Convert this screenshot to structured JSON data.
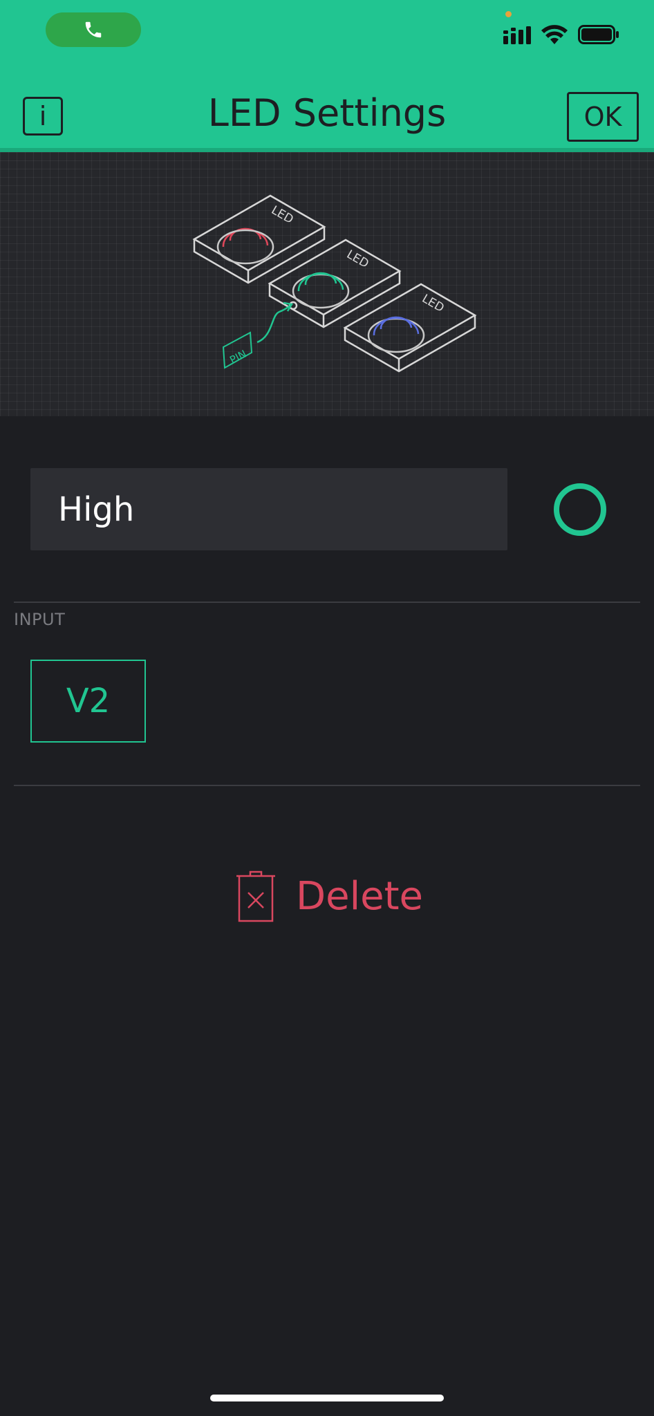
{
  "status_bar": {
    "call_icon": "phone-icon",
    "signal_icon": "cellular-signal-icon",
    "wifi_icon": "wifi-icon",
    "battery_icon": "battery-icon"
  },
  "header": {
    "info_label": "i",
    "title": "LED Settings",
    "ok_label": "OK",
    "background_color": "#21c591"
  },
  "illustration": {
    "leds": [
      {
        "label": "LED",
        "color": "#e0475a"
      },
      {
        "label": "LED",
        "color": "#21c591"
      },
      {
        "label": "LED",
        "color": "#5a6ee0"
      }
    ],
    "pin_label": "PIN"
  },
  "name_field": {
    "value": "High"
  },
  "color_picker": {
    "color": "#21c591"
  },
  "input_section": {
    "label": "INPUT",
    "pin_value": "V2"
  },
  "delete": {
    "label": "Delete",
    "icon": "trash-icon",
    "color": "#d9475f"
  }
}
